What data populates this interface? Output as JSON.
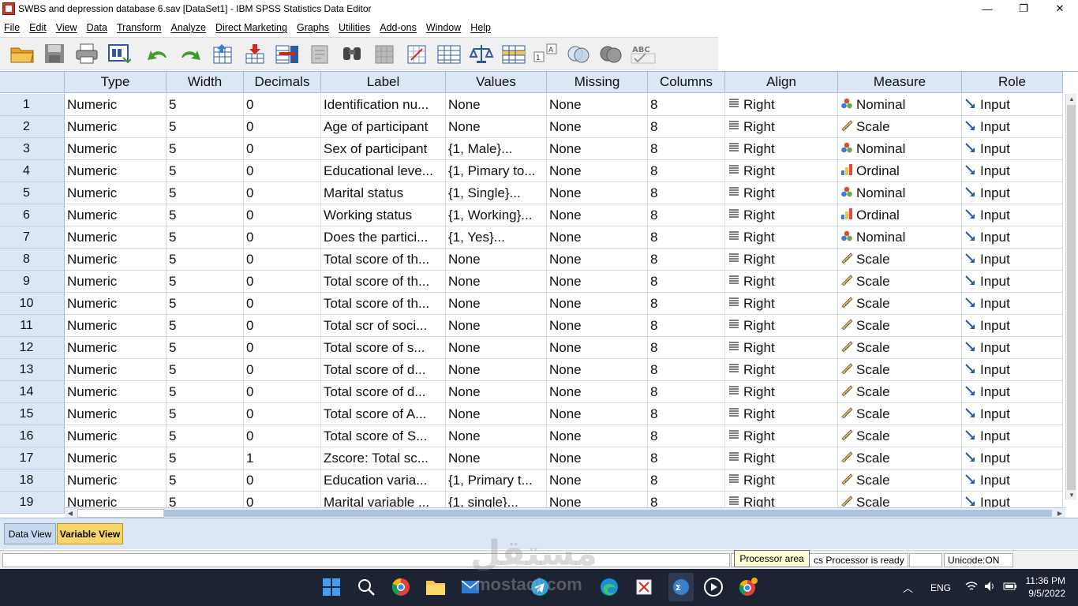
{
  "window": {
    "title": "SWBS and depression database 6.sav [DataSet1] - IBM SPSS Statistics Data Editor",
    "minimize": "—",
    "restore": "❐",
    "close": "✕"
  },
  "menu": [
    "File",
    "Edit",
    "View",
    "Data",
    "Transform",
    "Analyze",
    "Direct Marketing",
    "Graphs",
    "Utilities",
    "Add-ons",
    "Window",
    "Help"
  ],
  "grid": {
    "headers": [
      "Type",
      "Width",
      "Decimals",
      "Label",
      "Values",
      "Missing",
      "Columns",
      "Align",
      "Measure",
      "Role"
    ],
    "rows": [
      {
        "n": "1",
        "type": "Numeric",
        "width": "5",
        "dec": "0",
        "label": "Identification nu...",
        "values": "None",
        "missing": "None",
        "columns": "8",
        "align": "Right",
        "measure": "Nominal",
        "role": "Input"
      },
      {
        "n": "2",
        "type": "Numeric",
        "width": "5",
        "dec": "0",
        "label": "Age of participant",
        "values": "None",
        "missing": "None",
        "columns": "8",
        "align": "Right",
        "measure": "Scale",
        "role": "Input"
      },
      {
        "n": "3",
        "type": "Numeric",
        "width": "5",
        "dec": "0",
        "label": "Sex of participant",
        "values": "{1, Male}...",
        "missing": "None",
        "columns": "8",
        "align": "Right",
        "measure": "Nominal",
        "role": "Input"
      },
      {
        "n": "4",
        "type": "Numeric",
        "width": "5",
        "dec": "0",
        "label": "Educational leve...",
        "values": "{1, Pimary to...",
        "missing": "None",
        "columns": "8",
        "align": "Right",
        "measure": "Ordinal",
        "role": "Input"
      },
      {
        "n": "5",
        "type": "Numeric",
        "width": "5",
        "dec": "0",
        "label": "Marital status",
        "values": "{1, Single}...",
        "missing": "None",
        "columns": "8",
        "align": "Right",
        "measure": "Nominal",
        "role": "Input"
      },
      {
        "n": "6",
        "type": "Numeric",
        "width": "5",
        "dec": "0",
        "label": "Working status",
        "values": "{1, Working}...",
        "missing": "None",
        "columns": "8",
        "align": "Right",
        "measure": "Ordinal",
        "role": "Input"
      },
      {
        "n": "7",
        "type": "Numeric",
        "width": "5",
        "dec": "0",
        "label": "Does the partici...",
        "values": "{1, Yes}...",
        "missing": "None",
        "columns": "8",
        "align": "Right",
        "measure": "Nominal",
        "role": "Input"
      },
      {
        "n": "8",
        "type": "Numeric",
        "width": "5",
        "dec": "0",
        "label": "Total score of th...",
        "values": "None",
        "missing": "None",
        "columns": "8",
        "align": "Right",
        "measure": "Scale",
        "role": "Input"
      },
      {
        "n": "9",
        "type": "Numeric",
        "width": "5",
        "dec": "0",
        "label": "Total score of th...",
        "values": "None",
        "missing": "None",
        "columns": "8",
        "align": "Right",
        "measure": "Scale",
        "role": "Input"
      },
      {
        "n": "10",
        "type": "Numeric",
        "width": "5",
        "dec": "0",
        "label": "Total score of th...",
        "values": "None",
        "missing": "None",
        "columns": "8",
        "align": "Right",
        "measure": "Scale",
        "role": "Input"
      },
      {
        "n": "11",
        "type": "Numeric",
        "width": "5",
        "dec": "0",
        "label": "Total scr of soci...",
        "values": "None",
        "missing": "None",
        "columns": "8",
        "align": "Right",
        "measure": "Scale",
        "role": "Input"
      },
      {
        "n": "12",
        "type": "Numeric",
        "width": "5",
        "dec": "0",
        "label": "Total score of s...",
        "values": "None",
        "missing": "None",
        "columns": "8",
        "align": "Right",
        "measure": "Scale",
        "role": "Input"
      },
      {
        "n": "13",
        "type": "Numeric",
        "width": "5",
        "dec": "0",
        "label": "Total score of d...",
        "values": "None",
        "missing": "None",
        "columns": "8",
        "align": "Right",
        "measure": "Scale",
        "role": "Input"
      },
      {
        "n": "14",
        "type": "Numeric",
        "width": "5",
        "dec": "0",
        "label": "Total score of d...",
        "values": "None",
        "missing": "None",
        "columns": "8",
        "align": "Right",
        "measure": "Scale",
        "role": "Input"
      },
      {
        "n": "15",
        "type": "Numeric",
        "width": "5",
        "dec": "0",
        "label": "Total score of A...",
        "values": "None",
        "missing": "None",
        "columns": "8",
        "align": "Right",
        "measure": "Scale",
        "role": "Input"
      },
      {
        "n": "16",
        "type": "Numeric",
        "width": "5",
        "dec": "0",
        "label": "Total score of S...",
        "values": "None",
        "missing": "None",
        "columns": "8",
        "align": "Right",
        "measure": "Scale",
        "role": "Input"
      },
      {
        "n": "17",
        "type": "Numeric",
        "width": "5",
        "dec": "1",
        "label": "Zscore: Total sc...",
        "values": "None",
        "missing": "None",
        "columns": "8",
        "align": "Right",
        "measure": "Scale",
        "role": "Input"
      },
      {
        "n": "18",
        "type": "Numeric",
        "width": "5",
        "dec": "0",
        "label": "Education varia...",
        "values": "{1, Primary t...",
        "missing": "None",
        "columns": "8",
        "align": "Right",
        "measure": "Scale",
        "role": "Input"
      },
      {
        "n": "19",
        "type": "Numeric",
        "width": "5",
        "dec": "0",
        "label": "Marital variable ...",
        "values": "{1, single}...",
        "missing": "None",
        "columns": "8",
        "align": "Right",
        "measure": "Scale",
        "role": "Input"
      }
    ]
  },
  "tabs": {
    "data_view": "Data View",
    "variable_view": "Variable View"
  },
  "status": {
    "tooltip": "Processor area",
    "processor": "IBM SPSS Statistics Processor is ready",
    "processor_visible": "cs Processor is ready",
    "unicode": "Unicode:ON"
  },
  "taskbar": {
    "language": "ENG",
    "time": "11:36 PM",
    "date": "9/5/2022"
  },
  "watermark": {
    "arabic": "مستقل",
    "latin": "mostaql.com"
  },
  "colors": {
    "header_bg": "#dbe7f5",
    "active_tab": "#f8d56b",
    "taskbar": "#1c2433"
  }
}
